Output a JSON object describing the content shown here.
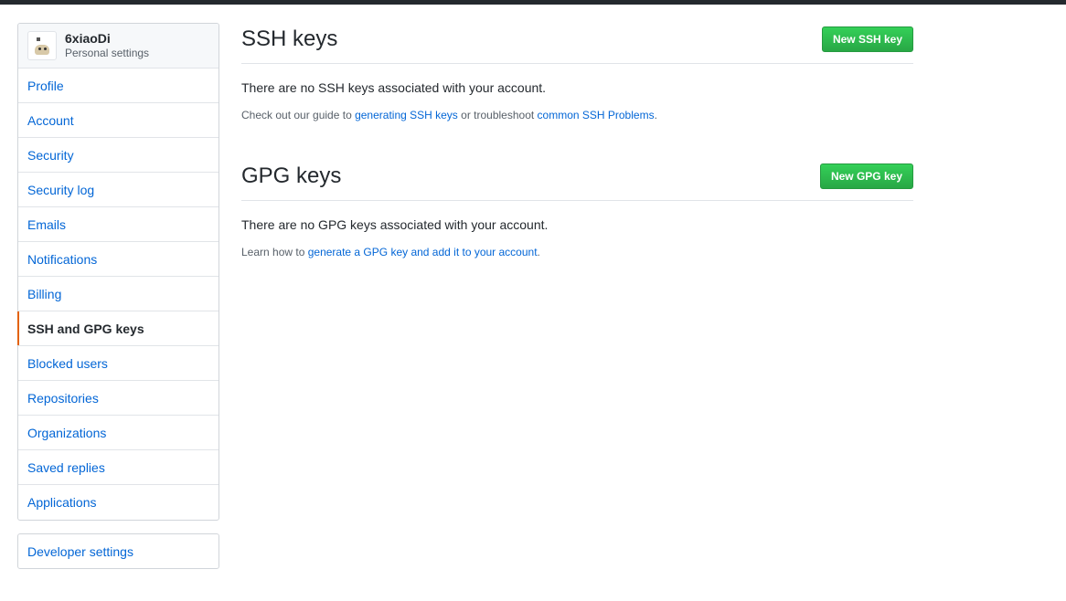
{
  "colors": {
    "link": "#0366d6",
    "accent_selected": "#e36209",
    "button_green": "#28a745",
    "topbar": "#24292e"
  },
  "sidebar": {
    "user": {
      "name": "6xiaoDi",
      "subtitle": "Personal settings",
      "avatar_icon": "user-avatar"
    },
    "items": [
      {
        "label": "Profile"
      },
      {
        "label": "Account"
      },
      {
        "label": "Security"
      },
      {
        "label": "Security log"
      },
      {
        "label": "Emails"
      },
      {
        "label": "Notifications"
      },
      {
        "label": "Billing"
      },
      {
        "label": "SSH and GPG keys",
        "selected": true
      },
      {
        "label": "Blocked users"
      },
      {
        "label": "Repositories"
      },
      {
        "label": "Organizations"
      },
      {
        "label": "Saved replies"
      },
      {
        "label": "Applications"
      }
    ],
    "developer_settings": "Developer settings"
  },
  "ssh": {
    "title": "SSH keys",
    "button": "New SSH key",
    "blank": "There are no SSH keys associated with your account.",
    "note_prefix": "Check out our guide to ",
    "note_link1": "generating SSH keys",
    "note_middle": " or troubleshoot ",
    "note_link2": "common SSH Problems",
    "note_suffix": "."
  },
  "gpg": {
    "title": "GPG keys",
    "button": "New GPG key",
    "blank": "There are no GPG keys associated with your account.",
    "note_prefix": "Learn how to ",
    "note_link": "generate a GPG key and add it to your account",
    "note_suffix": "."
  }
}
